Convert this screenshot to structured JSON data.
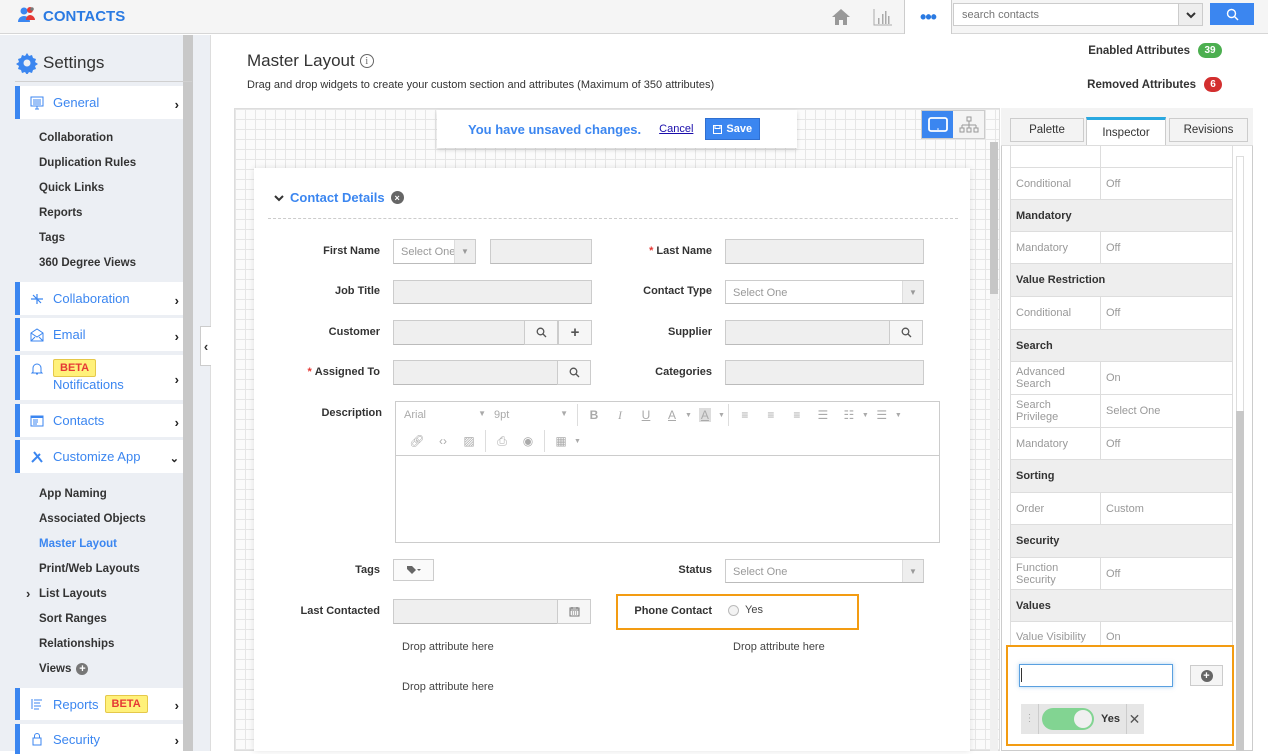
{
  "app": {
    "title": "CONTACTS",
    "colors": {
      "accent": "#3b86f0",
      "enabled": "#4caf50",
      "removed": "#d32f2f",
      "highlight": "#f39c12"
    }
  },
  "topnav": {
    "icons": [
      "home-icon",
      "chart-icon",
      "more-icon"
    ],
    "more_label": "•••",
    "search": {
      "placeholder": "search contacts",
      "value": ""
    }
  },
  "sidebar": {
    "title": "Settings",
    "items": [
      {
        "label": "General",
        "icon": "monitor-icon",
        "expanded": false
      },
      {
        "label": "Collaboration",
        "icon": "network-icon",
        "expanded": false
      },
      {
        "label": "Email",
        "icon": "email-icon",
        "expanded": false
      },
      {
        "label": "Notifications",
        "icon": "bell-icon",
        "badge": "BETA",
        "expanded": false
      },
      {
        "label": "Contacts",
        "icon": "contacts-icon",
        "expanded": false
      },
      {
        "label": "Customize App",
        "icon": "tools-icon",
        "expanded": true
      },
      {
        "label": "Reports",
        "icon": "report-icon",
        "badge": "BETA",
        "expanded": false
      },
      {
        "label": "Security",
        "icon": "lock-icon",
        "expanded": false
      }
    ],
    "general_sub": [
      "Collaboration",
      "Duplication Rules",
      "Quick Links",
      "Reports",
      "Tags",
      "360 Degree Views"
    ],
    "customize_sub": [
      "App Naming",
      "Associated Objects",
      "Master Layout",
      "Print/Web Layouts",
      "List Layouts",
      "Sort Ranges",
      "Relationships",
      "Views"
    ],
    "active_sub": "Master Layout"
  },
  "main": {
    "title": "Master Layout",
    "subtitle": "Drag and drop widgets to create your custom section and attributes (Maximum of 350 attributes)",
    "enabled_label": "Enabled Attributes",
    "enabled_count": "39",
    "removed_label": "Removed Attributes",
    "removed_count": "6",
    "unsaved_text": "You have unsaved changes.",
    "cancel_label": "Cancel",
    "save_label": "Save"
  },
  "section": {
    "title": "Contact Details",
    "fields": {
      "first_name": {
        "label": "First Name",
        "placeholder": "Select One"
      },
      "last_name": {
        "label": "Last Name",
        "required": true
      },
      "job_title": {
        "label": "Job Title"
      },
      "contact_type": {
        "label": "Contact Type",
        "placeholder": "Select One"
      },
      "customer": {
        "label": "Customer"
      },
      "supplier": {
        "label": "Supplier"
      },
      "assigned_to": {
        "label": "Assigned To",
        "required": true
      },
      "categories": {
        "label": "Categories"
      },
      "description": {
        "label": "Description",
        "font": "Arial",
        "size": "9pt"
      },
      "tags": {
        "label": "Tags"
      },
      "status": {
        "label": "Status",
        "placeholder": "Select One"
      },
      "last_contacted": {
        "label": "Last Contacted"
      },
      "phone_contact": {
        "label": "Phone Contact",
        "option": "Yes",
        "checked": false
      }
    },
    "drop_text": "Drop attribute here"
  },
  "inspector": {
    "tabs": [
      "Palette",
      "Inspector",
      "Revisions"
    ],
    "active_tab": "Inspector",
    "rows": [
      {
        "type": "row",
        "k": "",
        "v": ""
      },
      {
        "type": "row",
        "k": "Conditional",
        "v": "Off"
      },
      {
        "type": "group",
        "label": "Mandatory"
      },
      {
        "type": "row",
        "k": "Mandatory",
        "v": "Off"
      },
      {
        "type": "group",
        "label": "Value Restriction"
      },
      {
        "type": "row",
        "k": "Conditional",
        "v": "Off"
      },
      {
        "type": "group",
        "label": "Search"
      },
      {
        "type": "row",
        "k": "Advanced Search",
        "v": "On"
      },
      {
        "type": "row",
        "k": "Search Privilege",
        "v": "Select One"
      },
      {
        "type": "row",
        "k": "Mandatory",
        "v": "Off"
      },
      {
        "type": "group",
        "label": "Sorting"
      },
      {
        "type": "row",
        "k": "Order",
        "v": "Custom"
      },
      {
        "type": "group",
        "label": "Security"
      },
      {
        "type": "row",
        "k": "Function Security",
        "v": "Off"
      },
      {
        "type": "group",
        "label": "Values"
      },
      {
        "type": "row",
        "k": "Value Visibility",
        "v": "On"
      }
    ],
    "values": {
      "input_value": "",
      "items": [
        {
          "label": "Yes",
          "enabled": true
        }
      ]
    }
  }
}
